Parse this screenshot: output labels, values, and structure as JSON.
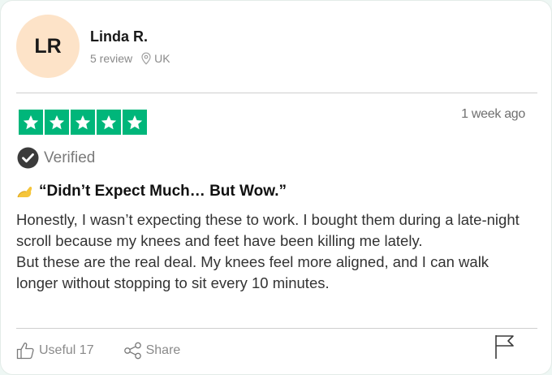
{
  "reviewer": {
    "initials": "LR",
    "name": "Linda R.",
    "review_count": "5 review",
    "location": "UK",
    "avatar_color": "#fde3c8"
  },
  "rating": {
    "stars": 5,
    "max_stars": 5,
    "color": "#00b67a",
    "date": "1 week ago"
  },
  "verified_label": "Verified",
  "review": {
    "title_icon": "flexed-arm-emoji",
    "title": "“Didn’t Expect Much… But Wow.”",
    "paragraphs": [
      "Honestly, I wasn’t expecting these to work. I bought them during a late-night scroll because my knees and feet have been killing me lately.",
      "But these are the real deal. My knees feel more aligned, and I can walk longer without stopping to sit every 10 minutes."
    ]
  },
  "actions": {
    "useful_label": "Useful 17",
    "share_label": "Share",
    "flag_icon": "flag-icon"
  }
}
